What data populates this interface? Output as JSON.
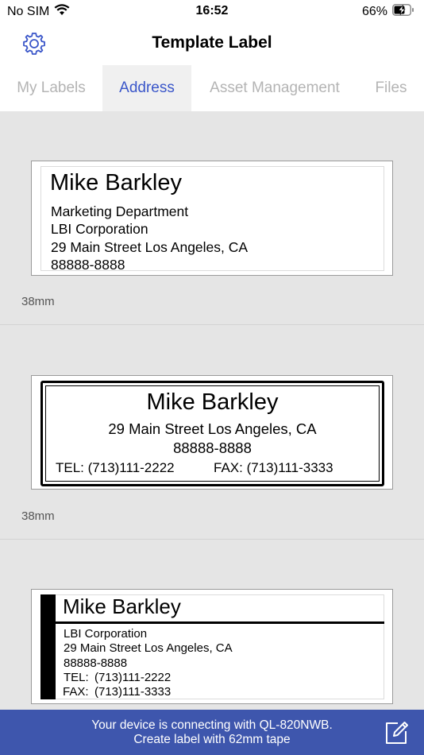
{
  "status_bar": {
    "carrier": "No SIM",
    "time": "16:52",
    "battery": "66%"
  },
  "nav": {
    "title": "Template Label"
  },
  "tabs": [
    {
      "label": "My Labels",
      "active": false
    },
    {
      "label": "Address",
      "active": true
    },
    {
      "label": "Asset Management",
      "active": false
    },
    {
      "label": "Files",
      "active": false
    }
  ],
  "templates": [
    {
      "size": "38mm",
      "name": "Mike Barkley",
      "lines": [
        "Marketing Department",
        "LBI Corporation",
        "29 Main Street Los Angeles, CA",
        "88888-8888"
      ]
    },
    {
      "size": "38mm",
      "name": "Mike Barkley",
      "address": "29 Main Street Los Angeles, CA",
      "zip": "88888-8888",
      "tel": "TEL: (713)111-2222",
      "fax": "FAX: (713)111-3333"
    },
    {
      "name": "Mike Barkley",
      "company": "LBI Corporation",
      "address": "29 Main Street Los Angeles, CA",
      "zip": "88888-8888",
      "tel_label": "TEL:",
      "tel": "(713)111-2222",
      "fax_label": "FAX:",
      "fax": "(713)111-3333"
    }
  ],
  "banner": {
    "line1": "Your device is connecting with QL-820NWB.",
    "line2": "Create label with 62mm tape"
  },
  "colors": {
    "accent": "#3a56c9",
    "banner": "#3e56ad",
    "background": "#e5e5e5"
  }
}
